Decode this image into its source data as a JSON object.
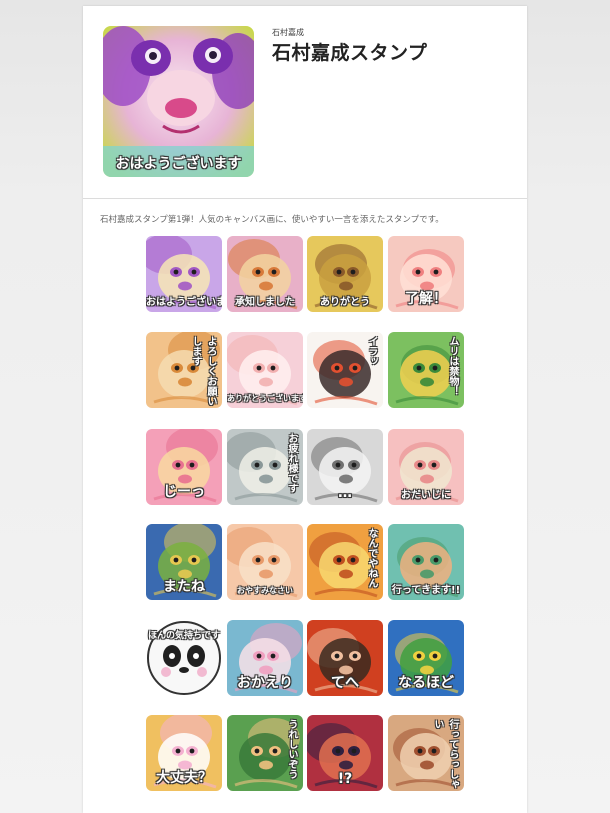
{
  "header": {
    "author": "石村嘉成",
    "title": "石村嘉成スタンプ",
    "main_caption": "おはようございます"
  },
  "description": "石村嘉成スタンプ第1弾！人気のキャンバス画に、使いやすい一言を添えたスタンプです。",
  "stickers": [
    {
      "animal": "panda",
      "caption": "おはようございます",
      "colors": [
        "#c9a6e8",
        "#a259c4",
        "#f7e6b5"
      ]
    },
    {
      "animal": "ram",
      "caption": "承知しました",
      "colors": [
        "#e8b0c8",
        "#d87a3a",
        "#f2d4a0"
      ]
    },
    {
      "animal": "sloth",
      "caption": "ありがとう",
      "colors": [
        "#e6c85c",
        "#8a5a2a",
        "#c9a040"
      ]
    },
    {
      "animal": "axolotl",
      "caption": "了解！",
      "colors": [
        "#f6c9c0",
        "#f08080",
        "#ffe0d6"
      ]
    },
    {
      "animal": "camel",
      "caption": "よろしくお願いします",
      "colors": [
        "#f2c28a",
        "#d98a3a",
        "#f6dcb0"
      ]
    },
    {
      "animal": "bear",
      "caption": "ありがとうございます",
      "colors": [
        "#f6d0d8",
        "#f2b0b0",
        "#fff0f0"
      ]
    },
    {
      "animal": "eagle",
      "caption": "イラッ",
      "colors": [
        "#f8f4f0",
        "#e25030",
        "#3a2a2a"
      ]
    },
    {
      "animal": "shoebill",
      "caption": "ムリは禁物！",
      "colors": [
        "#7cc060",
        "#3a8a3a",
        "#f2d050"
      ]
    },
    {
      "animal": "leopard",
      "caption": "じーっ",
      "colors": [
        "#f4a0b8",
        "#e87090",
        "#f8d8a0"
      ]
    },
    {
      "animal": "lion",
      "caption": "お疲れ様です",
      "colors": [
        "#c0c8c8",
        "#8a9898",
        "#f0f0e8"
      ]
    },
    {
      "animal": "white-tiger",
      "caption": "…",
      "colors": [
        "#d8d8d8",
        "#707070",
        "#f4f4f4"
      ]
    },
    {
      "animal": "pig",
      "caption": "おだいじに",
      "colors": [
        "#f6c0c0",
        "#e88a8a",
        "#f0e8d0"
      ]
    },
    {
      "animal": "turtle",
      "caption": "またね",
      "colors": [
        "#3a6ab0",
        "#e6c850",
        "#7ab040"
      ]
    },
    {
      "animal": "cat",
      "caption": "おやすみなさい",
      "colors": [
        "#f6c8a8",
        "#e89a6a",
        "#f8e0c8"
      ]
    },
    {
      "animal": "tiger",
      "caption": "なんでやねん",
      "colors": [
        "#f0a040",
        "#c05020",
        "#f8d870"
      ]
    },
    {
      "animal": "chameleon",
      "caption": "行ってきます!!",
      "colors": [
        "#70c0b0",
        "#4a9a6a",
        "#f0b080"
      ]
    },
    {
      "animal": "panda-face",
      "caption": "ほんの気持ちです",
      "colors": [
        "#f8f8f8",
        "#202020",
        "#f0a0c0"
      ]
    },
    {
      "animal": "rabbit",
      "caption": "おかえり",
      "colors": [
        "#7ab8d0",
        "#f0a0c0",
        "#f8e0e8"
      ]
    },
    {
      "animal": "red-panda",
      "caption": "てへ",
      "colors": [
        "#d04020",
        "#f0c0a0",
        "#3a2a20"
      ]
    },
    {
      "animal": "macaw",
      "caption": "なるほど",
      "colors": [
        "#3070c0",
        "#f0d040",
        "#40a040"
      ]
    },
    {
      "animal": "hamster",
      "caption": "大丈夫？",
      "colors": [
        "#f0c060",
        "#f4b0d0",
        "#ffffff"
      ]
    },
    {
      "animal": "crocodile",
      "caption": "うれしいぞう",
      "colors": [
        "#5aa050",
        "#f0c080",
        "#3a7a3a"
      ]
    },
    {
      "animal": "vulture",
      "caption": "!?",
      "colors": [
        "#b03040",
        "#302040",
        "#e07050"
      ]
    },
    {
      "animal": "owl",
      "caption": "行ってらっしゃい",
      "colors": [
        "#d8a880",
        "#a05030",
        "#f0d0b0"
      ]
    }
  ]
}
